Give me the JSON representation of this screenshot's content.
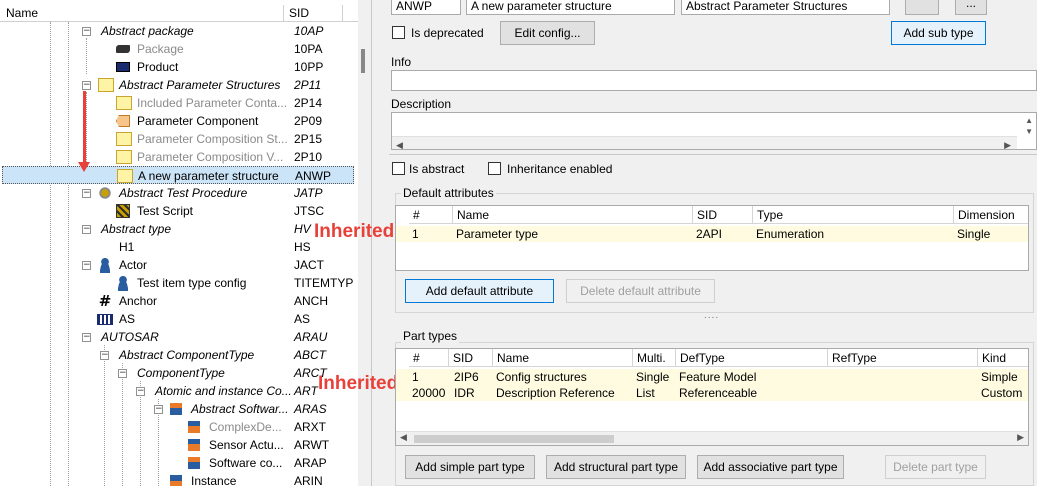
{
  "tree": {
    "header_name": "Name",
    "header_sid": "SID",
    "rows": [
      {
        "label": "Abstract package",
        "sid": "10AP"
      },
      {
        "label": "Package",
        "sid": "10PA"
      },
      {
        "label": "Product",
        "sid": "10PP"
      },
      {
        "label": "Abstract Parameter Structures",
        "sid": "2P11"
      },
      {
        "label": "Included Parameter Conta...",
        "sid": "2P14"
      },
      {
        "label": "Parameter Component",
        "sid": "2P09"
      },
      {
        "label": "Parameter Composition St...",
        "sid": "2P15"
      },
      {
        "label": "Parameter Composition V...",
        "sid": "2P10"
      },
      {
        "label": "A new parameter structure",
        "sid": "ANWP"
      },
      {
        "label": "Abstract Test Procedure",
        "sid": "JATP"
      },
      {
        "label": "Test Script",
        "sid": "JTSC"
      },
      {
        "label": "Abstract type",
        "sid": "HV"
      },
      {
        "label": "H1",
        "sid": "HS"
      },
      {
        "label": "Actor",
        "sid": "JACT"
      },
      {
        "label": "Test item type config",
        "sid": "TITEMTYP"
      },
      {
        "label": "Anchor",
        "sid": "ANCH"
      },
      {
        "label": "AS",
        "sid": "AS"
      },
      {
        "label": "AUTOSAR",
        "sid": "ARAU"
      },
      {
        "label": "Abstract ComponentType",
        "sid": "ABCT"
      },
      {
        "label": "ComponentType",
        "sid": "ARCT"
      },
      {
        "label": "Atomic and instance Co...",
        "sid": "ART"
      },
      {
        "label": "Abstract Softwar...",
        "sid": "ARAS"
      },
      {
        "label": "ComplexDe...",
        "sid": "ARXT"
      },
      {
        "label": "Sensor Actu...",
        "sid": "ARWT"
      },
      {
        "label": "Software co...",
        "sid": "ARAP"
      },
      {
        "label": "Instance",
        "sid": "ARIN"
      }
    ]
  },
  "annotation": "Inherited",
  "form": {
    "sid_value": "ANWP",
    "name_value": "A new parameter structure",
    "parent_value": "Abstract Parameter Structures",
    "browse_label": "...",
    "is_deprecated": "Is deprecated",
    "edit_config": "Edit config...",
    "add_sub_type": "Add sub type",
    "info_label": "Info",
    "description_label": "Description",
    "is_abstract": "Is abstract",
    "inheritance_enabled": "Inheritance enabled"
  },
  "default_attributes": {
    "title": "Default attributes",
    "columns": [
      "#",
      "Name",
      "SID",
      "Type",
      "Dimension"
    ],
    "rows": [
      {
        "num": "1",
        "name": "Parameter type",
        "sid": "2API",
        "type": "Enumeration",
        "dim": "Single"
      }
    ],
    "add_button": "Add default attribute",
    "delete_button": "Delete default attribute"
  },
  "splitter_grip": "....",
  "part_types": {
    "title": "Part types",
    "columns": [
      "#",
      "SID",
      "Name",
      "Multi.",
      "DefType",
      "RefType",
      "Kind"
    ],
    "rows": [
      {
        "num": "1",
        "sid": "2IP6",
        "name": "Config structures",
        "multi": "Single",
        "def": "Feature Model",
        "ref": "",
        "kind": "Simple"
      },
      {
        "num": "20000",
        "sid": "IDR",
        "name": "Description Reference",
        "multi": "List",
        "def": "Referenceable",
        "ref": "",
        "kind": "Custom"
      }
    ],
    "buttons": [
      "Add simple part type",
      "Add structural part type",
      "Add associative part type",
      "Delete part type"
    ]
  },
  "colors": {
    "accent": "#0078d7",
    "annotation": "#e8413a",
    "selection": "#cce4f7",
    "inherited_row": "#fffbe0"
  }
}
